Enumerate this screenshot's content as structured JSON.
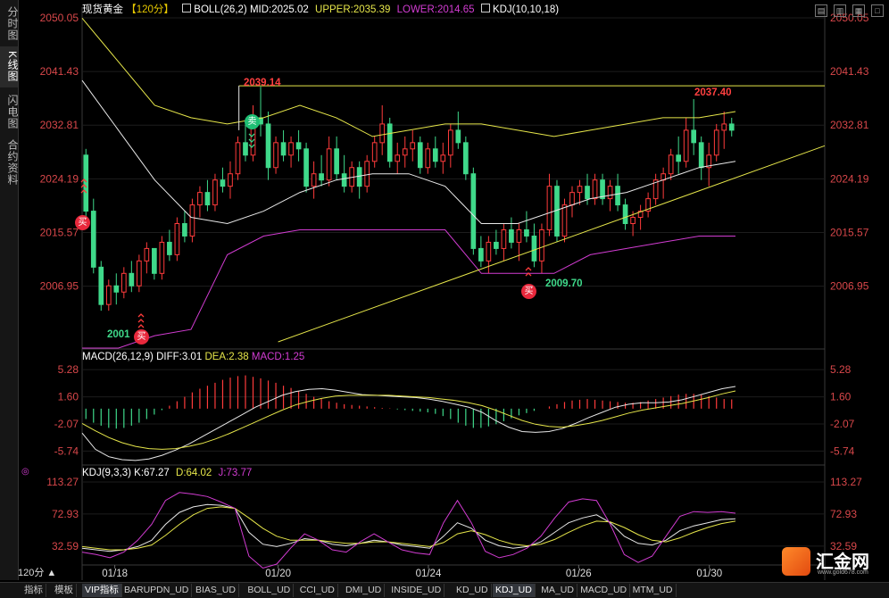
{
  "sidebar": {
    "items": [
      {
        "label": "分时图",
        "active": false
      },
      {
        "label": "K线图",
        "active": true
      },
      {
        "label": "闪电图",
        "active": false
      },
      {
        "label": "合约资料",
        "active": false
      }
    ]
  },
  "header": {
    "symbol": "现货黄金",
    "period": "【120分】",
    "boll": "BOLL(26,2)",
    "mid": "MID:2025.02",
    "upper": "UPPER:2035.39",
    "lower": "LOWER:2014.65",
    "kdj_overlay": "KDJ(10,10,18)"
  },
  "macd_header": {
    "title": "MACD(26,12,9)",
    "diff": "DIFF:3.01",
    "dea": "DEA:2.38",
    "macd": "MACD:1.25"
  },
  "kdj_header": {
    "title": "KDJ(9,3,3)",
    "k": "K:67.27",
    "d": "D:64.02",
    "j": "J:73.77"
  },
  "annotations": {
    "high_label": "2039.14",
    "high2_label": "2037.40",
    "low_label": "2009.70",
    "low2_label": "2001",
    "buy": "买",
    "sell": "卖"
  },
  "period_button": "120分 ▲",
  "tabs": [
    "指标",
    "模板",
    "VIP指标",
    "BARUPDN_UD",
    "BIAS_UD",
    "BOLL_UD",
    "CCI_UD",
    "DMI_UD",
    "INSIDE_UD",
    "KD_UD",
    "KDJ_UD",
    "MA_UD",
    "MACD_UD",
    "MTM_UD"
  ],
  "active_tab": "KDJ_UD",
  "logo": {
    "name": "汇金网",
    "url": "www.gold678.com"
  },
  "colors": {
    "up": "#ff3b3b",
    "down": "#3fd98a",
    "yellow": "#e6e64a",
    "magenta": "#d23cd2",
    "white": "#e8e8e8",
    "axis": "#d8474a"
  },
  "chart_data": [
    {
      "type": "candlestick",
      "title": "现货黄金 120分",
      "ylim": [
        1997,
        2050.05
      ],
      "yticks": [
        "2050.05",
        "2041.43",
        "2032.81",
        "2024.19",
        "2015.57",
        "2006.95"
      ],
      "xticks": [
        "01/18",
        "01/20",
        "01/24",
        "01/26",
        "01/30"
      ],
      "ohlc": [
        [
          2028,
          2029,
          2018,
          2019
        ],
        [
          2019,
          2021,
          2009,
          2010
        ],
        [
          2010,
          2011,
          2003,
          2004
        ],
        [
          2004,
          2008,
          2003,
          2007
        ],
        [
          2007,
          2009,
          2004,
          2006
        ],
        [
          2006,
          2010,
          2005,
          2009
        ],
        [
          2009,
          2011,
          2006,
          2007
        ],
        [
          2007,
          2012,
          2006,
          2011
        ],
        [
          2011,
          2014,
          2009,
          2013
        ],
        [
          2013,
          2013,
          2008,
          2009
        ],
        [
          2009,
          2015,
          2008,
          2014
        ],
        [
          2014,
          2016,
          2011,
          2012
        ],
        [
          2012,
          2018,
          2011,
          2017
        ],
        [
          2017,
          2019,
          2014,
          2015
        ],
        [
          2015,
          2021,
          2014,
          2020
        ],
        [
          2020,
          2023,
          2018,
          2022
        ],
        [
          2022,
          2024,
          2019,
          2020
        ],
        [
          2020,
          2025,
          2019,
          2024
        ],
        [
          2024,
          2026,
          2022,
          2023
        ],
        [
          2023,
          2027,
          2021,
          2025
        ],
        [
          2025,
          2031,
          2024,
          2030
        ],
        [
          2030,
          2033,
          2027,
          2028
        ],
        [
          2028,
          2036,
          2027,
          2034
        ],
        [
          2034,
          2039,
          2031,
          2033
        ],
        [
          2033,
          2035,
          2024,
          2026
        ],
        [
          2026,
          2031,
          2025,
          2030
        ],
        [
          2030,
          2032,
          2027,
          2028
        ],
        [
          2028,
          2031,
          2026,
          2030
        ],
        [
          2030,
          2032,
          2027,
          2029
        ],
        [
          2029,
          2030,
          2022,
          2023
        ],
        [
          2023,
          2027,
          2021,
          2025
        ],
        [
          2025,
          2028,
          2023,
          2024
        ],
        [
          2024,
          2031,
          2023,
          2029
        ],
        [
          2029,
          2031,
          2024,
          2025
        ],
        [
          2025,
          2028,
          2022,
          2023
        ],
        [
          2023,
          2027,
          2022,
          2026
        ],
        [
          2026,
          2027,
          2021,
          2023
        ],
        [
          2023,
          2028,
          2022,
          2027
        ],
        [
          2027,
          2031,
          2026,
          2030
        ],
        [
          2030,
          2036,
          2028,
          2033
        ],
        [
          2033,
          2034,
          2026,
          2027
        ],
        [
          2027,
          2030,
          2025,
          2028
        ],
        [
          2028,
          2031,
          2026,
          2029
        ],
        [
          2029,
          2032,
          2027,
          2030
        ],
        [
          2030,
          2031,
          2025,
          2026
        ],
        [
          2026,
          2030,
          2025,
          2029
        ],
        [
          2029,
          2031,
          2026,
          2027
        ],
        [
          2027,
          2030,
          2025,
          2028
        ],
        [
          2028,
          2033,
          2026,
          2032
        ],
        [
          2032,
          2035,
          2029,
          2030
        ],
        [
          2030,
          2031,
          2024,
          2025
        ],
        [
          2025,
          2026,
          2012,
          2013
        ],
        [
          2013,
          2015,
          2010,
          2011
        ],
        [
          2011,
          2015,
          2009,
          2014
        ],
        [
          2014,
          2016,
          2012,
          2013
        ],
        [
          2013,
          2017,
          2011,
          2016
        ],
        [
          2016,
          2018,
          2013,
          2014
        ],
        [
          2014,
          2017,
          2011,
          2016
        ],
        [
          2016,
          2019,
          2014,
          2015
        ],
        [
          2015,
          2017,
          2010,
          2011
        ],
        [
          2011,
          2017,
          2009,
          2016
        ],
        [
          2016,
          2025,
          2015,
          2023
        ],
        [
          2023,
          2024,
          2014,
          2015
        ],
        [
          2015,
          2021,
          2014,
          2020
        ],
        [
          2020,
          2023,
          2018,
          2022
        ],
        [
          2022,
          2024,
          2020,
          2023
        ],
        [
          2023,
          2025,
          2020,
          2021
        ],
        [
          2021,
          2025,
          2020,
          2024
        ],
        [
          2024,
          2025,
          2020,
          2021
        ],
        [
          2021,
          2024,
          2019,
          2023
        ],
        [
          2023,
          2025,
          2019,
          2020
        ],
        [
          2020,
          2021,
          2016,
          2017
        ],
        [
          2017,
          2019,
          2015,
          2018
        ],
        [
          2018,
          2020,
          2016,
          2019
        ],
        [
          2019,
          2022,
          2018,
          2021
        ],
        [
          2021,
          2025,
          2020,
          2024
        ],
        [
          2024,
          2026,
          2021,
          2025
        ],
        [
          2025,
          2029,
          2024,
          2028
        ],
        [
          2028,
          2031,
          2025,
          2027
        ],
        [
          2027,
          2034,
          2026,
          2032
        ],
        [
          2032,
          2037,
          2028,
          2030
        ],
        [
          2030,
          2031,
          2024,
          2026
        ],
        [
          2026,
          2030,
          2023,
          2028
        ],
        [
          2028,
          2033,
          2027,
          2032
        ],
        [
          2032,
          2035,
          2029,
          2033
        ],
        [
          2033,
          2034,
          2031,
          2032
        ]
      ],
      "boll_upper": [
        2050,
        2043,
        2036,
        2034,
        2033,
        2034,
        2036,
        2034,
        2031,
        2032,
        2033,
        2033,
        2032,
        2031,
        2032,
        2033,
        2034,
        2034,
        2035
      ],
      "boll_mid": [
        2040,
        2032,
        2024,
        2018,
        2017,
        2019,
        2022,
        2024,
        2025,
        2025,
        2023,
        2017,
        2017,
        2019,
        2021,
        2022,
        2024,
        2026,
        2027
      ],
      "boll_lower": [
        1997,
        1997,
        1999,
        2000,
        2012,
        2015,
        2016,
        2016,
        2016,
        2016,
        2016,
        2009,
        2009,
        2009,
        2012,
        2013,
        2014,
        2015,
        2015
      ],
      "trendline": [
        [
          0.3,
          1998.0
        ],
        [
          1.0,
          2029.5
        ]
      ],
      "resistance": 2039.14
    },
    {
      "type": "bar+line",
      "title": "MACD(26,12,9)",
      "ylim": [
        -7.5,
        6.5
      ],
      "yticks": [
        "5.28",
        "1.60",
        "-2.07",
        "-5.74"
      ],
      "macd": [
        -1.4,
        -1.9,
        -2.3,
        -2.6,
        -2.7,
        -2.6,
        -2.3,
        -1.9,
        -1.4,
        -0.8,
        -0.2,
        0.4,
        1.0,
        1.6,
        2.2,
        2.7,
        3.1,
        3.5,
        3.9,
        4.2,
        4.4,
        4.5,
        4.3,
        4.1,
        3.8,
        3.5,
        3.1,
        2.8,
        2.4,
        2.0,
        1.6,
        1.3,
        1.0,
        0.8,
        0.6,
        0.5,
        0.4,
        0.3,
        0.2,
        0.1,
        0.05,
        -0.1,
        -0.2,
        -0.3,
        -0.4,
        -0.5,
        -0.7,
        -1.0,
        -1.4,
        -1.9,
        -2.3,
        -2.6,
        -2.6,
        -2.4,
        -2.1,
        -1.7,
        -1.3,
        -0.9,
        -0.6,
        -0.3,
        0.0,
        0.3,
        0.6,
        0.9,
        1.1,
        1.2,
        1.3,
        1.2,
        1.1,
        1.0,
        0.9,
        0.8,
        0.8,
        0.9,
        1.1,
        1.3,
        1.5,
        1.7,
        1.9,
        2.0,
        2.0,
        1.9,
        1.7,
        1.5,
        1.3,
        1.25
      ],
      "diff": [
        -3.3,
        -5.5,
        -6.5,
        -6.9,
        -7.0,
        -6.8,
        -6.3,
        -5.6,
        -4.8,
        -3.8,
        -2.8,
        -1.8,
        -0.8,
        0.2,
        1.0,
        1.8,
        2.3,
        2.6,
        2.7,
        2.5,
        2.2,
        1.9,
        1.8,
        1.7,
        1.6,
        1.5,
        1.3,
        1.0,
        0.6,
        0.2,
        -0.5,
        -1.6,
        -2.5,
        -3.1,
        -3.2,
        -3.1,
        -2.7,
        -2.0,
        -1.2,
        -0.5,
        0.2,
        0.6,
        0.8,
        0.8,
        0.9,
        1.2,
        1.7,
        2.2,
        2.7,
        3.0
      ],
      "dea": [
        -2.0,
        -3.0,
        -3.9,
        -4.6,
        -5.1,
        -5.4,
        -5.5,
        -5.4,
        -5.1,
        -4.7,
        -4.1,
        -3.4,
        -2.6,
        -1.8,
        -1.0,
        -0.2,
        0.5,
        1.0,
        1.4,
        1.7,
        1.8,
        1.8,
        1.8,
        1.8,
        1.7,
        1.6,
        1.5,
        1.3,
        1.1,
        0.8,
        0.4,
        -0.2,
        -0.9,
        -1.6,
        -2.1,
        -2.4,
        -2.5,
        -2.3,
        -2.0,
        -1.6,
        -1.1,
        -0.6,
        -0.2,
        0.1,
        0.4,
        0.7,
        1.1,
        1.5,
        2.0,
        2.4
      ]
    },
    {
      "type": "line",
      "title": "KDJ(9,3,3)",
      "ylim": [
        10,
        120
      ],
      "yticks": [
        "113.27",
        "72.93",
        "32.59"
      ],
      "k": [
        30,
        28,
        26,
        28,
        32,
        40,
        60,
        75,
        82,
        85,
        84,
        80,
        50,
        35,
        32,
        36,
        42,
        40,
        35,
        33,
        36,
        40,
        38,
        34,
        32,
        30,
        45,
        62,
        55,
        40,
        33,
        30,
        32,
        38,
        50,
        62,
        68,
        72,
        62,
        45,
        36,
        34,
        40,
        52,
        58,
        62,
        66,
        67
      ],
      "d": [
        32,
        30,
        28,
        28,
        30,
        34,
        46,
        60,
        72,
        80,
        82,
        80,
        68,
        55,
        45,
        40,
        40,
        40,
        38,
        36,
        36,
        38,
        38,
        36,
        34,
        32,
        37,
        48,
        52,
        47,
        40,
        35,
        33,
        35,
        41,
        50,
        58,
        64,
        63,
        56,
        47,
        40,
        38,
        43,
        50,
        56,
        61,
        64
      ],
      "j": [
        25,
        22,
        18,
        25,
        40,
        60,
        90,
        100,
        98,
        95,
        88,
        80,
        20,
        5,
        10,
        30,
        48,
        40,
        28,
        25,
        38,
        48,
        38,
        28,
        24,
        22,
        62,
        90,
        62,
        26,
        18,
        22,
        30,
        45,
        68,
        88,
        92,
        90,
        60,
        22,
        12,
        20,
        45,
        70,
        76,
        75,
        76,
        74
      ]
    }
  ]
}
